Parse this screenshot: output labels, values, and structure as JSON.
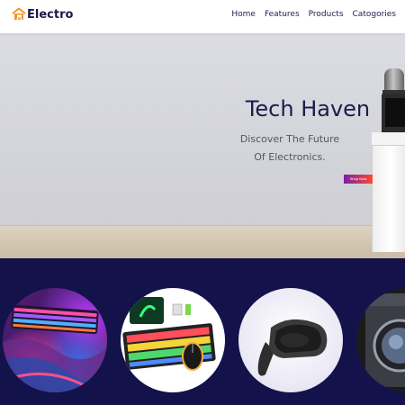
{
  "brand": {
    "name": "Electro",
    "icon": "home-cart-icon",
    "accent": "#f7941d"
  },
  "nav": {
    "items": [
      "Home",
      "Features",
      "Products",
      "Catogories"
    ]
  },
  "hero": {
    "title": "Tech Haven",
    "subtitle": "Discover The Future Of Electronics.",
    "button": "Shop Now",
    "button_colors": [
      "#7a1fa8",
      "#ff4a2a"
    ]
  },
  "products": {
    "background": "#14124a",
    "items": [
      "keyboard-image",
      "gaming-keyboard-mouse-image",
      "vr-headset-image",
      "washing-machine-image"
    ]
  },
  "colors": {
    "text_dark": "#1b1b4c"
  }
}
